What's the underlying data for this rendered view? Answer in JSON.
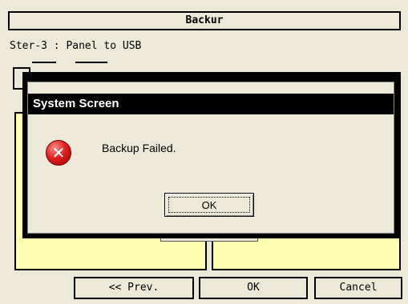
{
  "window": {
    "title": "Backur"
  },
  "step": {
    "text": "Ster-3 : Panel to USB"
  },
  "footer": {
    "prev_label": "<< Prev.",
    "ok_label": "OK",
    "cancel_label": "Cancel"
  },
  "dialog": {
    "title": "System Screen",
    "icon": "error-icon",
    "message": "Backup Failed.",
    "ok_label": "OK"
  },
  "colors": {
    "panel": "#fffdb0",
    "background": "#ece9d8",
    "dialog_title": "#000000",
    "error_icon": "#e02020"
  }
}
